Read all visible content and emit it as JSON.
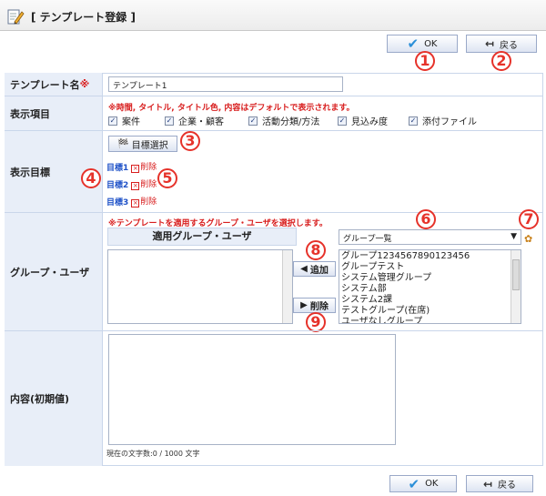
{
  "header": {
    "title": "[ テンプレート登録 ]",
    "icon": "edit-document-icon"
  },
  "buttons": {
    "ok": "OK",
    "back": "戻る"
  },
  "callouts": [
    "1",
    "2",
    "3",
    "4",
    "5",
    "6",
    "7",
    "8",
    "9"
  ],
  "form": {
    "template_name": {
      "label": "テンプレート名",
      "required_mark": "※",
      "value": "テンプレート1"
    },
    "display_items": {
      "label": "表示項目",
      "note": "※時間, タイトル, タイトル色, 内容はデフォルトで表示されます。",
      "options": [
        "案件",
        "企業・顧客",
        "活動分類/方法",
        "見込み度",
        "添付ファイル"
      ]
    },
    "display_goals": {
      "label": "表示目標",
      "select_button": "目標選択",
      "goals": [
        "目標1",
        "目標2",
        "目標3"
      ],
      "delete_label": "削除"
    },
    "group_user": {
      "label": "グループ・ユーザ",
      "note": "※テンプレートを適用するグループ・ユーザを選択します。",
      "applied_header": "適用グループ・ユーザ",
      "add_button": "追加",
      "remove_button": "削除",
      "dropdown_value": "グループ一覧",
      "list": [
        "グループ1234567890123456",
        "グループテスト",
        "システム管理グループ",
        "システム部",
        "システム2課",
        "テストグループ(在席)",
        "ユーザなしグループ"
      ]
    },
    "content": {
      "label": "内容(初期値)",
      "counter_text": "現在の文字数:0 / 1000 文字"
    }
  }
}
